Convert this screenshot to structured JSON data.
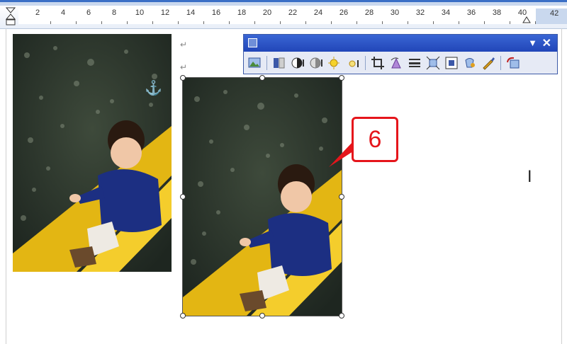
{
  "ruler": {
    "ticks": [
      "2",
      "4",
      "6",
      "8",
      "10",
      "12",
      "14",
      "16",
      "18",
      "20",
      "22",
      "24",
      "26",
      "28",
      "30",
      "32",
      "34",
      "36",
      "38",
      "40",
      "42"
    ],
    "right_value": "42"
  },
  "toolbar": {
    "title_icon": "picture-toolbar-icon",
    "buttons": [
      {
        "name": "insert-picture-icon"
      },
      {
        "name": "color-icon"
      },
      {
        "name": "more-contrast-icon"
      },
      {
        "name": "less-contrast-icon"
      },
      {
        "name": "more-brightness-icon"
      },
      {
        "name": "less-brightness-icon"
      },
      {
        "name": "crop-icon"
      },
      {
        "name": "rotate-icon"
      },
      {
        "name": "line-style-icon"
      },
      {
        "name": "compress-picture-icon"
      },
      {
        "name": "text-wrapping-icon"
      },
      {
        "name": "format-picture-icon"
      },
      {
        "name": "set-transparent-color-icon"
      },
      {
        "name": "reset-picture-icon"
      }
    ]
  },
  "callout": {
    "label": "6"
  },
  "colors": {
    "accent_red": "#e5151b",
    "toolbar_blue": "#2146b8"
  }
}
